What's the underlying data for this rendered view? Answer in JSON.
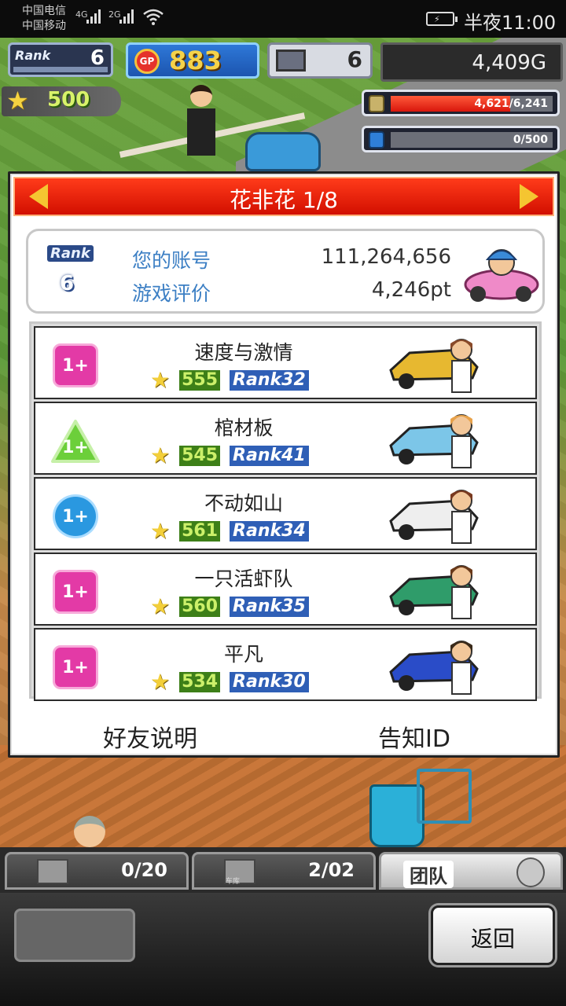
{
  "status_bar": {
    "carrier_1": "中国电信",
    "carrier_2": "中国移动",
    "net_1": "4G",
    "net_2": "2G",
    "time": "半夜11:00"
  },
  "hud": {
    "rank_label": "Rank",
    "rank_value": "6",
    "gp_icon": "GP",
    "gp_value": "883",
    "pc_value": "6",
    "money": "4,409G",
    "star_value": "500",
    "gauge_1": {
      "text": "4,621/6,241",
      "fill": 0.74
    },
    "gauge_2": {
      "text": "0/500",
      "fill": 0
    }
  },
  "panel": {
    "title": "花非花 1/8",
    "account": {
      "rank_label": "Rank",
      "rank_value": "6",
      "account_label": "您的账号",
      "account_value": "111,264,656",
      "rating_label": "游戏评价",
      "rating_value": "4,246pt"
    },
    "rows": [
      {
        "badge": "1+",
        "badge_style": "pink",
        "name": "速度与激情",
        "score": "555",
        "rank_label": "Rank",
        "rank": "32",
        "kart_color": "#e7b830",
        "hair": "#8a4b2a"
      },
      {
        "badge": "1+",
        "badge_style": "green",
        "name": "棺材板",
        "score": "545",
        "rank_label": "Rank",
        "rank": "41",
        "kart_color": "#7cc6e8",
        "hair": "#e8a24a"
      },
      {
        "badge": "1+",
        "badge_style": "blue",
        "name": "不动如山",
        "score": "561",
        "rank_label": "Rank",
        "rank": "34",
        "kart_color": "#eeeeee",
        "hair": "#7a3a20"
      },
      {
        "badge": "1+",
        "badge_style": "pink",
        "name": "一只活虾队",
        "score": "560",
        "rank_label": "Rank",
        "rank": "35",
        "kart_color": "#2f9c6a",
        "hair": "#6a3a1a"
      },
      {
        "badge": "1+",
        "badge_style": "pink",
        "name": "平凡",
        "score": "534",
        "rank_label": "Rank",
        "rank": "30",
        "kart_color": "#2a4cc8",
        "hair": "#3a2a1a"
      }
    ],
    "friend_help": "好友说明",
    "notify_id": "告知ID"
  },
  "bottom": {
    "tab_1_count": "0/20",
    "tab_2_label": "车库",
    "tab_2_count": "2/02",
    "tab_3_label": "团队",
    "back": "返回"
  }
}
